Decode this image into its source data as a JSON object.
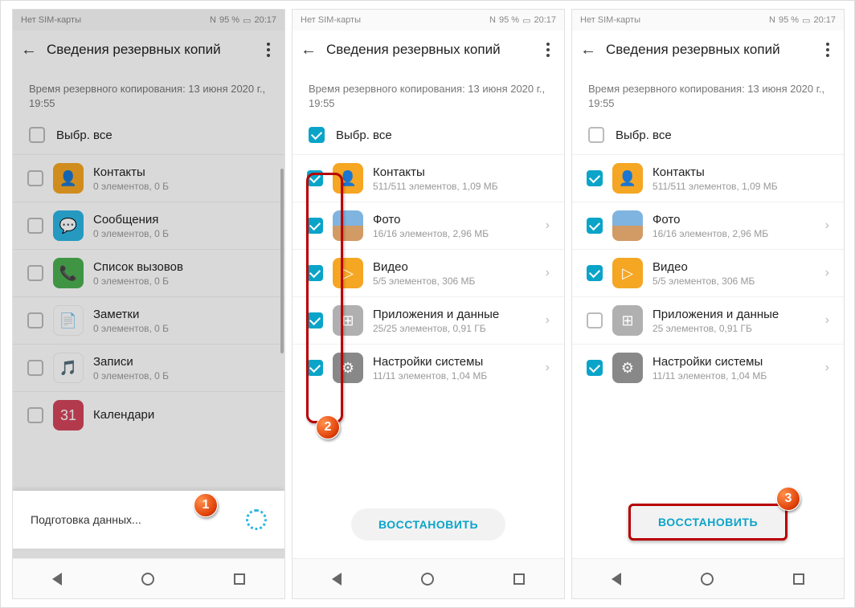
{
  "status": {
    "left": "Нет SIM-карты",
    "nfc": "N",
    "batt": "95 %",
    "time": "20:17"
  },
  "page_title": "Сведения резервных копий",
  "backup_time": "Время резервного копирования: 13 июня 2020 г., 19:55",
  "select_all": "Выбр. все",
  "screen1_items": [
    {
      "name": "Контакты",
      "sub": "0 элементов, 0 Б",
      "cls": "ic-contacts",
      "icon": "👤"
    },
    {
      "name": "Сообщения",
      "sub": "0 элементов, 0 Б",
      "cls": "ic-msg",
      "icon": "💬"
    },
    {
      "name": "Список вызовов",
      "sub": "0 элементов, 0 Б",
      "cls": "ic-call",
      "icon": "📞"
    },
    {
      "name": "Заметки",
      "sub": "0 элементов, 0 Б",
      "cls": "ic-notes",
      "icon": "📄"
    },
    {
      "name": "Записи",
      "sub": "0 элементов, 0 Б",
      "cls": "ic-rec",
      "icon": "🎵"
    },
    {
      "name": "Календари",
      "sub": "",
      "cls": "ic-cal",
      "icon": "31"
    }
  ],
  "screen2_items": [
    {
      "name": "Контакты",
      "sub": "511/511 элементов, 1,09 МБ",
      "cls": "ic-contacts",
      "icon": "👤",
      "chev": false,
      "chk": true
    },
    {
      "name": "Фото",
      "sub": "16/16 элементов, 2,96 МБ",
      "cls": "ic-photo",
      "icon": "",
      "chev": true,
      "chk": true
    },
    {
      "name": "Видео",
      "sub": "5/5 элементов, 306 МБ",
      "cls": "ic-video",
      "icon": "▷",
      "chev": true,
      "chk": true
    },
    {
      "name": "Приложения и данные",
      "sub": "25/25 элементов, 0,91 ГБ",
      "cls": "ic-apps",
      "icon": "⊞",
      "chev": true,
      "chk": true
    },
    {
      "name": "Настройки системы",
      "sub": "11/11 элементов, 1,04 МБ",
      "cls": "ic-settings",
      "icon": "⚙",
      "chev": true,
      "chk": true
    }
  ],
  "screen3_items": [
    {
      "name": "Контакты",
      "sub": "511/511 элементов, 1,09 МБ",
      "cls": "ic-contacts",
      "icon": "👤",
      "chev": false,
      "chk": true
    },
    {
      "name": "Фото",
      "sub": "16/16 элементов, 2,96 МБ",
      "cls": "ic-photo",
      "icon": "",
      "chev": true,
      "chk": true
    },
    {
      "name": "Видео",
      "sub": "5/5 элементов, 306 МБ",
      "cls": "ic-video",
      "icon": "▷",
      "chev": true,
      "chk": true
    },
    {
      "name": "Приложения и данные",
      "sub": "25 элементов, 0,91 ГБ",
      "cls": "ic-apps",
      "icon": "⊞",
      "chev": true,
      "chk": false
    },
    {
      "name": "Настройки системы",
      "sub": "11/11 элементов, 1,04 МБ",
      "cls": "ic-settings",
      "icon": "⚙",
      "chev": true,
      "chk": true
    }
  ],
  "preparing": "Подготовка данных...",
  "restore": "ВОССТАНОВИТЬ",
  "badges": {
    "b1": "1",
    "b2": "2",
    "b3": "3"
  }
}
